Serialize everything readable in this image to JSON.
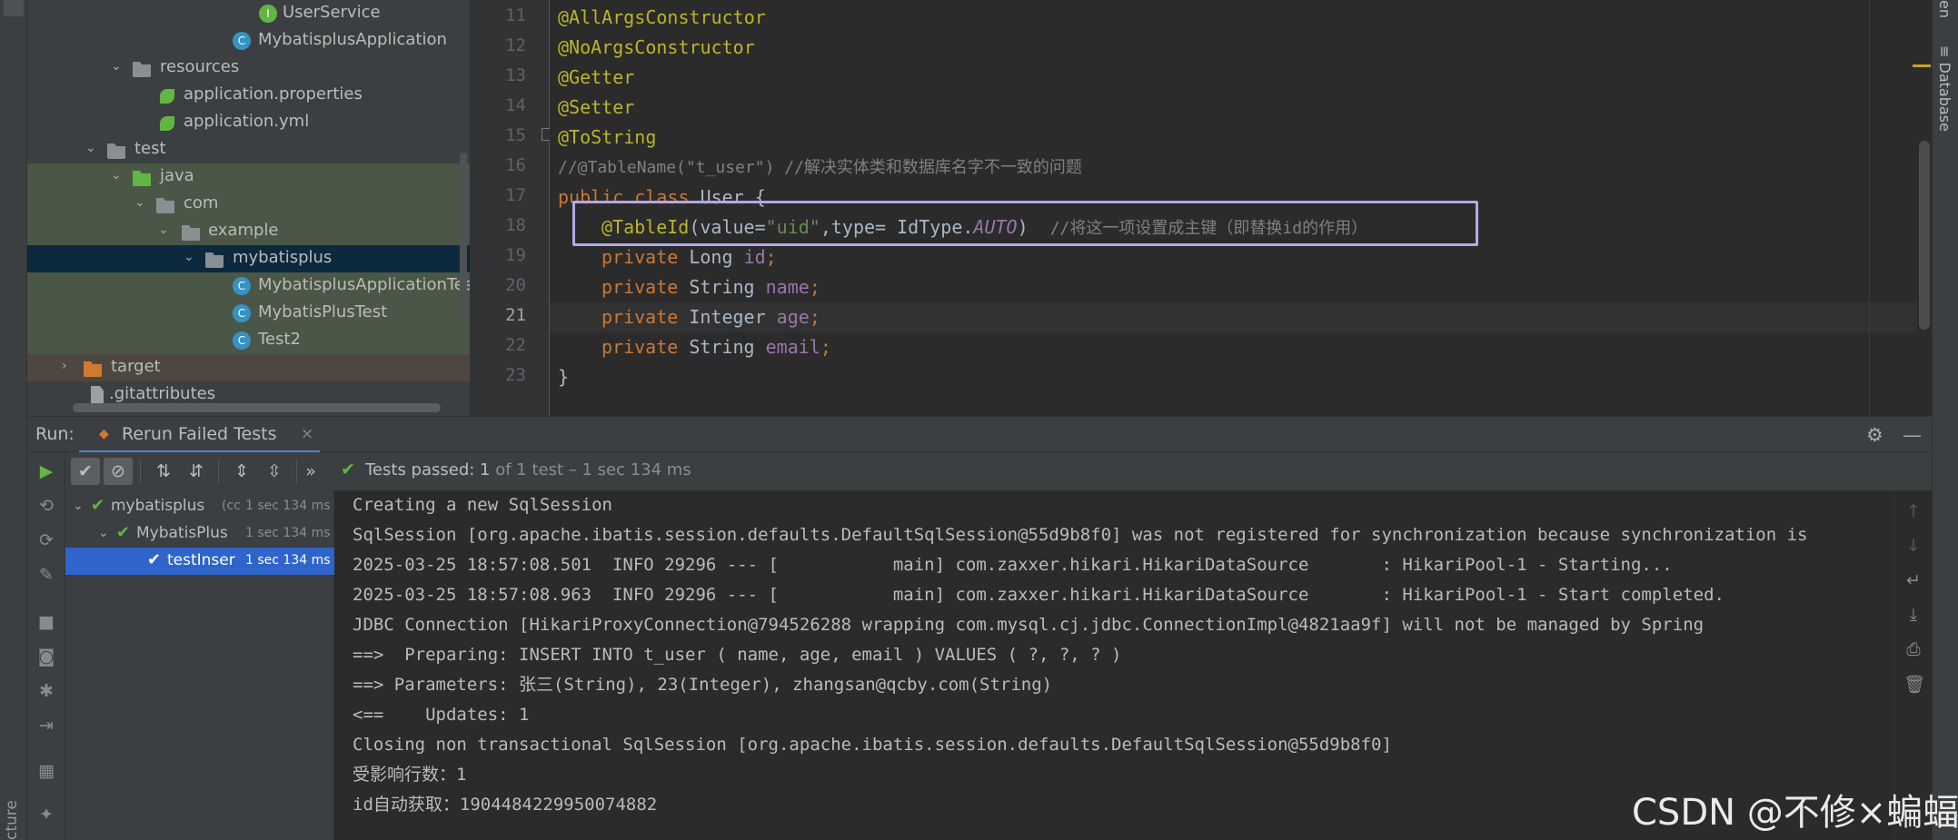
{
  "project_tree": [
    {
      "label": "UserService",
      "icon": "interface-icon"
    },
    {
      "label": "MybatisplusApplication",
      "icon": "spring-class-icon"
    },
    {
      "label": "resources",
      "icon": "resources-folder-icon"
    },
    {
      "label": "application.properties",
      "icon": "spring-config-icon"
    },
    {
      "label": "application.yml",
      "icon": "spring-config-icon"
    },
    {
      "label": "test",
      "icon": "folder-icon"
    },
    {
      "label": "java",
      "icon": "test-folder-icon"
    },
    {
      "label": "com",
      "icon": "package-icon"
    },
    {
      "label": "example",
      "icon": "package-icon"
    },
    {
      "label": "mybatisplus",
      "icon": "package-icon"
    },
    {
      "label": "MybatisplusApplicationTes",
      "icon": "test-class-icon"
    },
    {
      "label": "MybatisPlusTest",
      "icon": "test-class-icon"
    },
    {
      "label": "Test2",
      "icon": "test-class-icon"
    },
    {
      "label": "target",
      "icon": "excluded-folder-icon"
    },
    {
      "label": ".gitattributes",
      "icon": "file-icon"
    }
  ],
  "editor": {
    "line_numbers": [
      "11",
      "12",
      "13",
      "14",
      "15",
      "16",
      "17",
      "18",
      "19",
      "20",
      "21",
      "22",
      "23"
    ],
    "lines": {
      "l11": "@AllArgsConstructor",
      "l12": "@NoArgsConstructor",
      "l13": "@Getter",
      "l14": "@Setter",
      "l15": "@ToString",
      "l16": "//@TableName(\"t_user\") //解决实体类和数据库名字不一致的问题",
      "l17_kw1": "public",
      "l17_kw2": "class",
      "l17_rest": "User {",
      "l18_ann": "@TableId",
      "l18_p1": "(value=",
      "l18_str": "\"uid\"",
      "l18_p2": ",type= IdType.",
      "l18_auto": "AUTO",
      "l18_p3": ")  ",
      "l18_cmt": "//将这一项设置成主键（即替换id的作用）",
      "f_kw": "private",
      "l19_type": "Long",
      "l19_name": "id",
      "l20_type": "String",
      "l20_name": "name",
      "l21_type": "Integer",
      "l21_name": "age",
      "l22_type": "String",
      "l22_name": "email",
      "semi": ";",
      "l23": "}"
    }
  },
  "right_strip": {
    "database_label": "Database",
    "top_label": "en"
  },
  "left_strip": {
    "structure_label": "cture"
  },
  "run_panel": {
    "run_label": "Run:",
    "tab_label": "Rerun Failed Tests",
    "status_bold": "Tests passed: ",
    "status_count": "1",
    "status_rest": " of 1 test – 1 sec 134 ms",
    "more_chevron": "»",
    "test_tree": [
      {
        "name": "mybatisplus",
        "suffix": "(cc",
        "time": "1 sec 134 ms"
      },
      {
        "name": "MybatisPlus",
        "suffix": "",
        "time": "1 sec 134 ms"
      },
      {
        "name": "testInser",
        "suffix": "",
        "time": "1 sec 134 ms"
      }
    ],
    "console_lines": [
      "Creating a new SqlSession",
      "SqlSession [org.apache.ibatis.session.defaults.DefaultSqlSession@55d9b8f0] was not registered for synchronization because synchronization is",
      "2025-03-25 18:57:08.501  INFO 29296 --- [           main] com.zaxxer.hikari.HikariDataSource       : HikariPool-1 - Starting...",
      "2025-03-25 18:57:08.963  INFO 29296 --- [           main] com.zaxxer.hikari.HikariDataSource       : HikariPool-1 - Start completed.",
      "JDBC Connection [HikariProxyConnection@794526288 wrapping com.mysql.cj.jdbc.ConnectionImpl@4821aa9f] will not be managed by Spring",
      "==>  Preparing: INSERT INTO t_user ( name, age, email ) VALUES ( ?, ?, ? )",
      "==> Parameters: 张三(String), 23(Integer), zhangsan@qcby.com(String)",
      "<==    Updates: 1",
      "Closing non transactional SqlSession [org.apache.ibatis.session.defaults.DefaultSqlSession@55d9b8f0]",
      "受影响行数：1",
      "id自动获取：1904484229950074882"
    ]
  },
  "watermark": "CSDN @不修×蝙蝠",
  "colors": {
    "annotation": "#bbb529",
    "keyword": "#cc7832",
    "field": "#9876aa",
    "string": "#6a8759",
    "comment": "#808080",
    "highlight_box": "#b4a7e6",
    "pass_green": "#62b543",
    "selection_blue": "#2f65ca"
  }
}
